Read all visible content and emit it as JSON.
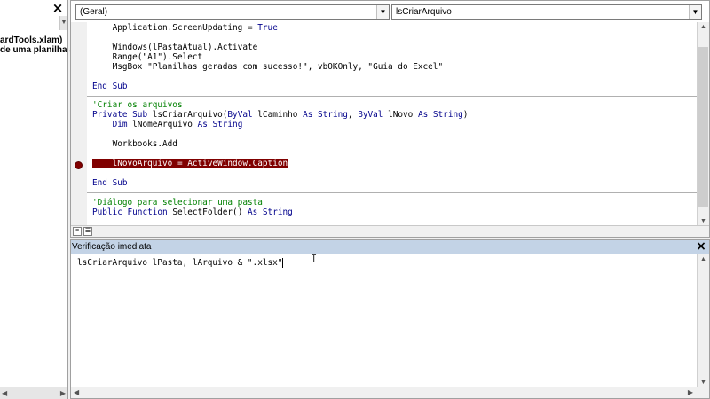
{
  "project_pane": {
    "close_icon": "×",
    "tree_items": [
      "ardTools.xlam)",
      "de uma planilha aut"
    ]
  },
  "code_window": {
    "object_combo": "(Geral)",
    "procedure_combo": "lsCriarArquivo",
    "lines": {
      "l0": {
        "plain": "    Application.ScreenUpdating = ",
        "kw": "True"
      },
      "l1": "    Windows(lPastaAtual).Activate",
      "l2": "    Range(\"A1\").Select",
      "l3": "    MsgBox \"Planilhas geradas com sucesso!\", vbOKOnly, \"Guia do Excel\"",
      "l4": "End Sub",
      "l5": "'Criar os arquivos",
      "l6": {
        "kw1": "Private Sub",
        "name": " lsCriarArquivo(",
        "kw2": "ByVal",
        "p1": " lCaminho ",
        "kw3": "As String",
        "comma": ", ",
        "kw4": "ByVal",
        "p2": " lNovo ",
        "kw5": "As String",
        "close": ")"
      },
      "l7": {
        "kw1": "    Dim",
        "mid": " lNomeArquivo ",
        "kw2": "As String"
      },
      "l8": "    Workbooks.Add",
      "l9": "    lNovoArquivo = ActiveWindow.Caption",
      "l10": "End Sub",
      "l11": "'Diálogo para selecionar uma pasta",
      "l12": {
        "kw1": "Public Function",
        "mid": " SelectFolder() ",
        "kw2": "As String"
      }
    }
  },
  "immediate_window": {
    "title": "Verificação imediata",
    "close_icon": "×",
    "text": "lsCriarArquivo lPasta, lArquivo & \".xlsx\"",
    "ibeam": "I"
  },
  "colors": {
    "breakpoint": "#800000",
    "keyword": "#00008b",
    "comment": "#008000",
    "title_bar": "#c3d3e6"
  },
  "icons": {
    "breakpoint": "breakpoint-icon",
    "close": "close-icon"
  }
}
